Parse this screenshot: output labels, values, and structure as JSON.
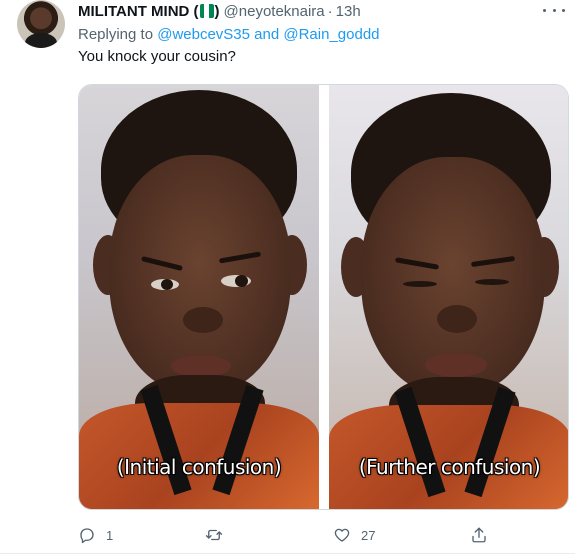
{
  "tweet": {
    "display_name": "MILITANT MIND (",
    "display_name_close": ")",
    "handle": "@neyoteknaira",
    "separator": "·",
    "time": "13h",
    "replying_prefix": "Replying to ",
    "replying_user_1": "@webcevS35",
    "replying_and": " and ",
    "replying_user_2": "@Rain_goddd",
    "text": "You knock your cousin?",
    "media": {
      "left_caption": "(Initial confusion)",
      "right_caption": "(Further confusion)"
    },
    "actions": {
      "reply_count": "1",
      "retweet_count": "",
      "like_count": "27"
    }
  },
  "icons": {
    "reply": "comment-icon",
    "retweet": "retweet-icon",
    "like": "heart-icon",
    "share": "share-icon",
    "more": "more-icon",
    "flag": "nigeria-flag-icon"
  },
  "colors": {
    "link": "#1d9bf0",
    "secondary_text": "#536471",
    "primary_text": "#0f1419",
    "flag_green": "#008751"
  }
}
